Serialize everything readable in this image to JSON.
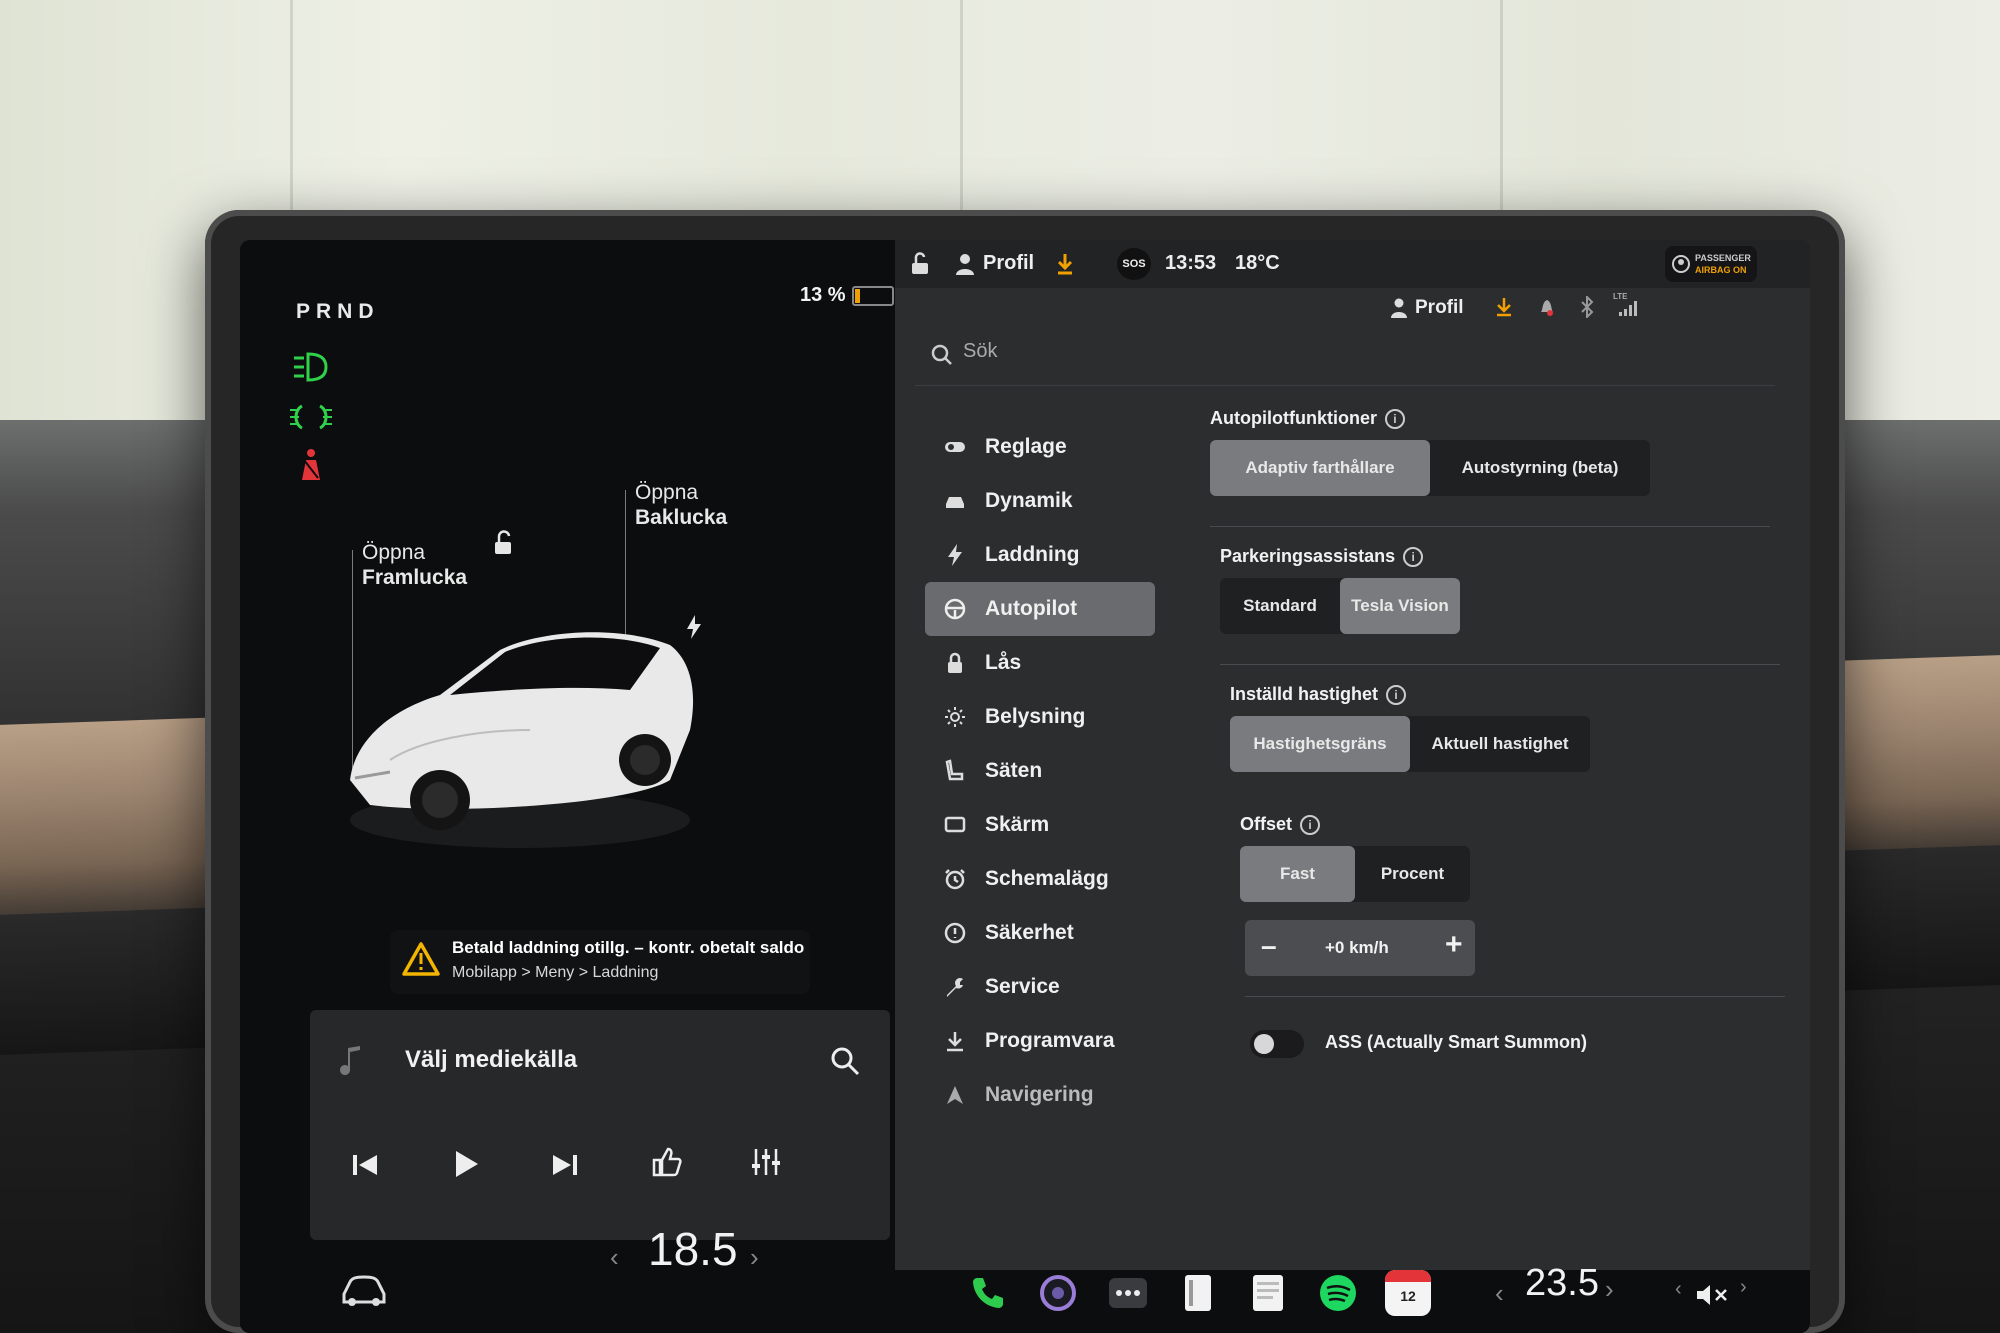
{
  "left_panel": {
    "gear": "PRND",
    "battery_percent": "13 %",
    "battery_level": 0.13,
    "callouts": {
      "frunk_line1": "Öppna",
      "frunk_line2": "Framlucka",
      "trunk_line1": "Öppna",
      "trunk_line2": "Baklucka"
    },
    "warning": {
      "title": "Betald laddning otillg. – kontr. obetalt saldo",
      "path": "Mobilapp > Meny > Laddning"
    },
    "media": {
      "source_label": "Välj mediekälla"
    },
    "driver_temp": "18.5"
  },
  "top_bar": {
    "profile": "Profil",
    "sos": "SOS",
    "time": "13:53",
    "outside_temp": "18°C",
    "airbag_line1": "PASSENGER",
    "airbag_line2": "AIRBAG ON"
  },
  "sub_bar": {
    "profile": "Profil",
    "network": "LTE"
  },
  "search": {
    "placeholder": "Sök"
  },
  "menu": {
    "items": [
      {
        "label": "Reglage",
        "icon": "toggle-icon"
      },
      {
        "label": "Dynamik",
        "icon": "car-icon"
      },
      {
        "label": "Laddning",
        "icon": "bolt-icon"
      },
      {
        "label": "Autopilot",
        "icon": "steering-wheel-icon",
        "active": true
      },
      {
        "label": "Lås",
        "icon": "lock-icon"
      },
      {
        "label": "Belysning",
        "icon": "sun-icon"
      },
      {
        "label": "Säten",
        "icon": "seat-icon"
      },
      {
        "label": "Skärm",
        "icon": "display-icon"
      },
      {
        "label": "Schemalägg",
        "icon": "alarm-clock-icon"
      },
      {
        "label": "Säkerhet",
        "icon": "info-circle-icon"
      },
      {
        "label": "Service",
        "icon": "wrench-icon"
      },
      {
        "label": "Programvara",
        "icon": "download-icon"
      },
      {
        "label": "Navigering",
        "icon": "navigation-arrow-icon"
      }
    ]
  },
  "settings": {
    "autopilot": {
      "title": "Autopilotfunktioner",
      "options": [
        "Adaptiv farthållare",
        "Autostyrning (beta)"
      ],
      "selected": 0
    },
    "parking": {
      "title": "Parkeringsassistans",
      "options": [
        "Standard",
        "Tesla Vision"
      ],
      "selected": 1
    },
    "speed": {
      "title": "Inställd hastighet",
      "options": [
        "Hastighetsgräns",
        "Aktuell hastighet"
      ],
      "selected": 0
    },
    "offset": {
      "title": "Offset",
      "options": [
        "Fast",
        "Procent"
      ],
      "selected": 0,
      "value": "+0 km/h",
      "minus": "–",
      "plus": "+"
    },
    "ass": {
      "label": "ASS (Actually Smart Summon)",
      "enabled": false
    }
  },
  "dock": {
    "calendar_day": "12",
    "passenger_temp": "23.5"
  }
}
